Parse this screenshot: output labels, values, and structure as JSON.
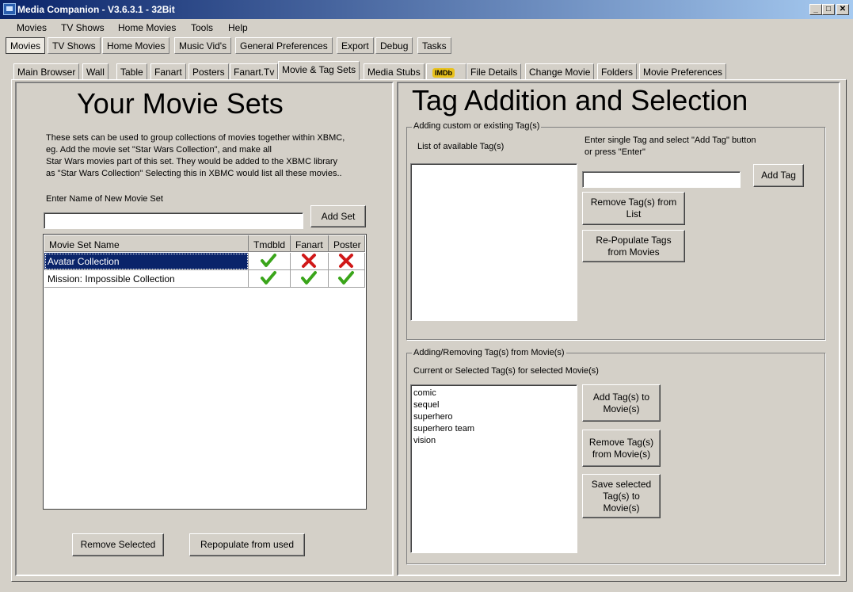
{
  "window": {
    "title": "Media Companion - V3.6.3.1 - 32Bit"
  },
  "menu": [
    "Movies",
    "TV Shows",
    "Home Movies",
    "Tools",
    "Help"
  ],
  "top_tabs": [
    "Movies",
    "TV Shows",
    "Home Movies",
    "Music Vid's",
    "General Preferences",
    "Export",
    "Debug",
    "Tasks"
  ],
  "sub_tabs": [
    "Main Browser",
    "Wall",
    "Table",
    "Fanart",
    "Posters",
    "Fanart.Tv",
    "Movie & Tag Sets",
    "Media Stubs",
    "IMDb",
    "File Details",
    "Change Movie",
    "Folders",
    "Movie Preferences"
  ],
  "sets": {
    "heading": "Your Movie Sets",
    "description": [
      "These sets can be used to group collections of movies together within XBMC,",
      "eg. Add the movie set \"Star Wars Collection\", and make all",
      "Star Wars movies part of this set. They would be added to the XBMC library",
      "as \"Star Wars Collection\" Selecting this in XBMC would list all these movies.."
    ],
    "new_set_label": "Enter Name of New Movie Set",
    "new_set_value": "",
    "add_set_label": "Add Set",
    "columns": [
      "Movie Set Name",
      "Tmdbld",
      "Fanart",
      "Poster"
    ],
    "rows": [
      {
        "name": "Avatar Collection",
        "tmdb": "check",
        "fanart": "cross",
        "poster": "cross",
        "selected": true
      },
      {
        "name": "Mission: Impossible Collection",
        "tmdb": "check",
        "fanart": "check",
        "poster": "check",
        "selected": false
      }
    ],
    "remove_selected_label": "Remove Selected",
    "repopulate_label": "Repopulate from used"
  },
  "tags": {
    "heading": "Tag Addition and Selection",
    "group1_legend": "Adding custom or existing Tag(s)",
    "available_label": "List of available Tag(s)",
    "instructions": [
      "Enter single Tag and select \"Add Tag\" button",
      "or press \"Enter\""
    ],
    "new_tag_value": "",
    "add_tag_label": "Add Tag",
    "remove_tags_label": [
      "Remove Tag(s) from",
      "List"
    ],
    "repopulate_tags_label": [
      "Re-Populate Tags",
      "from Movies"
    ],
    "group2_legend": "Adding/Removing Tag(s) from Movie(s)",
    "current_label": "Current or Selected Tag(s) for selected Movie(s)",
    "current_tags": [
      "comic",
      "sequel",
      "superhero",
      "superhero team",
      "vision"
    ],
    "add_to_movie_label": [
      "Add Tag(s) to",
      "Movie(s)"
    ],
    "remove_from_movie_label": [
      "Remove Tag(s)",
      "from Movie(s)"
    ],
    "save_selected_label": [
      "Save selected",
      "Tag(s) to",
      "Movie(s)"
    ]
  },
  "colors": {
    "selection": "#0a246a",
    "check": "#3aa51a",
    "cross": "#d01818"
  }
}
